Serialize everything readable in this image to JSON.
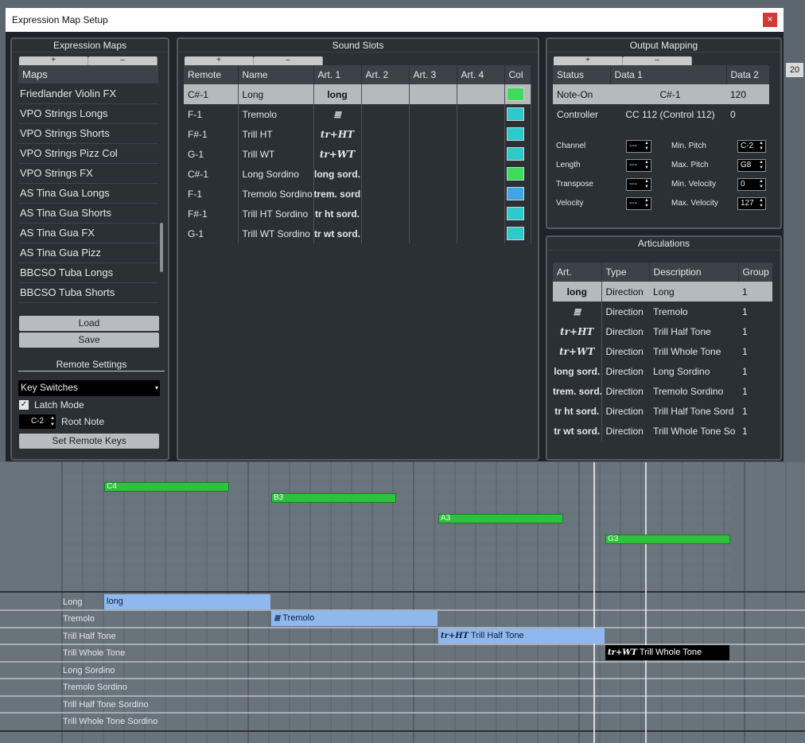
{
  "dialog": {
    "title": "Expression Map Setup",
    "close_label": "×"
  },
  "background": {
    "bar_number": "20"
  },
  "notes": [
    {
      "label": "C4"
    },
    {
      "label": "B3"
    },
    {
      "label": "A3"
    },
    {
      "label": "G3"
    }
  ],
  "art_lanes": [
    "Long",
    "Tremolo",
    "Trill Half Tone",
    "Trill Whole Tone",
    "Long Sordino",
    "Tremolo Sordino",
    "Trill Half Tone Sordino",
    "Trill Whole Tone Sordino"
  ],
  "art_events": [
    {
      "symbol": "",
      "label": "long"
    },
    {
      "symbol": "≣",
      "label": "Tremolo"
    },
    {
      "symbol": "tr+HT",
      "label": "Trill Half Tone"
    },
    {
      "symbol": "tr+WT",
      "label": "Trill Whole Tone"
    }
  ],
  "maps_panel": {
    "title": "Expression Maps",
    "add_label": "+",
    "remove_label": "–",
    "header": "Maps",
    "items": [
      "Friedlander Violin FX",
      "VPO Strings Longs",
      "VPO Strings Shorts",
      "VPO Strings Pizz Col",
      "VPO Strings FX",
      "AS Tina Gua Longs",
      "AS Tina Gua Shorts",
      "AS Tina Gua FX",
      "AS Tina Gua Pizz",
      "BBCSO Tuba Longs",
      "BBCSO Tuba Shorts"
    ],
    "load_label": "Load",
    "save_label": "Save",
    "remote_title": "Remote Settings",
    "remote_mode": "Key Switches",
    "latch_label": "Latch Mode",
    "root_note_value": "C-2",
    "root_note_label": "Root Note",
    "set_remote_label": "Set Remote Keys"
  },
  "sound_slots": {
    "title": "Sound Slots",
    "add_label": "+",
    "remove_label": "–",
    "columns": [
      "Remote",
      "Name",
      "Art. 1",
      "Art. 2",
      "Art. 3",
      "Art. 4",
      "Col"
    ],
    "rows": [
      {
        "remote": "C#-1",
        "name": "Long",
        "art1": "long",
        "color": "#3ddc5a"
      },
      {
        "remote": "F-1",
        "name": "Tremolo",
        "art1": "≣",
        "color": "#2ec9c9"
      },
      {
        "remote": "F#-1",
        "name": "Trill HT",
        "art1": "tr+HT",
        "color": "#2ec9c9"
      },
      {
        "remote": "G-1",
        "name": "Trill WT",
        "art1": "tr+WT",
        "color": "#2ec9c9"
      },
      {
        "remote": "C#-1",
        "name": "Long Sordino",
        "art1": "long sord.",
        "color": "#3ddc5a"
      },
      {
        "remote": "F-1",
        "name": "Tremolo Sordino",
        "art1": "trem. sord.",
        "color": "#3ea6e8"
      },
      {
        "remote": "F#-1",
        "name": "Trill HT Sordino",
        "art1": "tr ht sord.",
        "color": "#2ec9c9"
      },
      {
        "remote": "G-1",
        "name": "Trill WT Sordino",
        "art1": "tr wt sord.",
        "color": "#2ec9c9"
      }
    ]
  },
  "output_mapping": {
    "title": "Output Mapping",
    "add_label": "+",
    "remove_label": "–",
    "columns": [
      "Status",
      "Data 1",
      "Data 2"
    ],
    "rows": [
      {
        "status": "Note-On",
        "data1": "C#-1",
        "data2": "120"
      },
      {
        "status": "Controller",
        "data1": "CC 112  (Control 112)",
        "data2": "0"
      }
    ],
    "params_left": [
      {
        "label": "Channel",
        "value": "---"
      },
      {
        "label": "Length",
        "value": "---"
      },
      {
        "label": "Transpose",
        "value": "---"
      },
      {
        "label": "Velocity",
        "value": "---"
      }
    ],
    "params_right": [
      {
        "label": "Min. Pitch",
        "value": "C-2"
      },
      {
        "label": "Max. Pitch",
        "value": "G8"
      },
      {
        "label": "Min. Velocity",
        "value": "0"
      },
      {
        "label": "Max. Velocity",
        "value": "127"
      }
    ]
  },
  "articulations": {
    "title": "Articulations",
    "columns": [
      "Art.",
      "Type",
      "Description",
      "Group"
    ],
    "rows": [
      {
        "art": "long",
        "type": "Direction",
        "description": "Long",
        "group": "1"
      },
      {
        "art": "≣",
        "type": "Direction",
        "description": "Tremolo",
        "group": "1"
      },
      {
        "art": "tr+HT",
        "type": "Direction",
        "description": "Trill Half Tone",
        "group": "1"
      },
      {
        "art": "tr+WT",
        "type": "Direction",
        "description": "Trill Whole Tone",
        "group": "1"
      },
      {
        "art": "long sord.",
        "type": "Direction",
        "description": "Long Sordino",
        "group": "1"
      },
      {
        "art": "trem. sord.",
        "type": "Direction",
        "description": "Tremolo Sordino",
        "group": "1"
      },
      {
        "art": "tr ht sord.",
        "type": "Direction",
        "description": "Trill Half Tone Sord",
        "group": "1"
      },
      {
        "art": "tr wt sord.",
        "type": "Direction",
        "description": "Trill Whole Tone So",
        "group": "1"
      }
    ]
  }
}
